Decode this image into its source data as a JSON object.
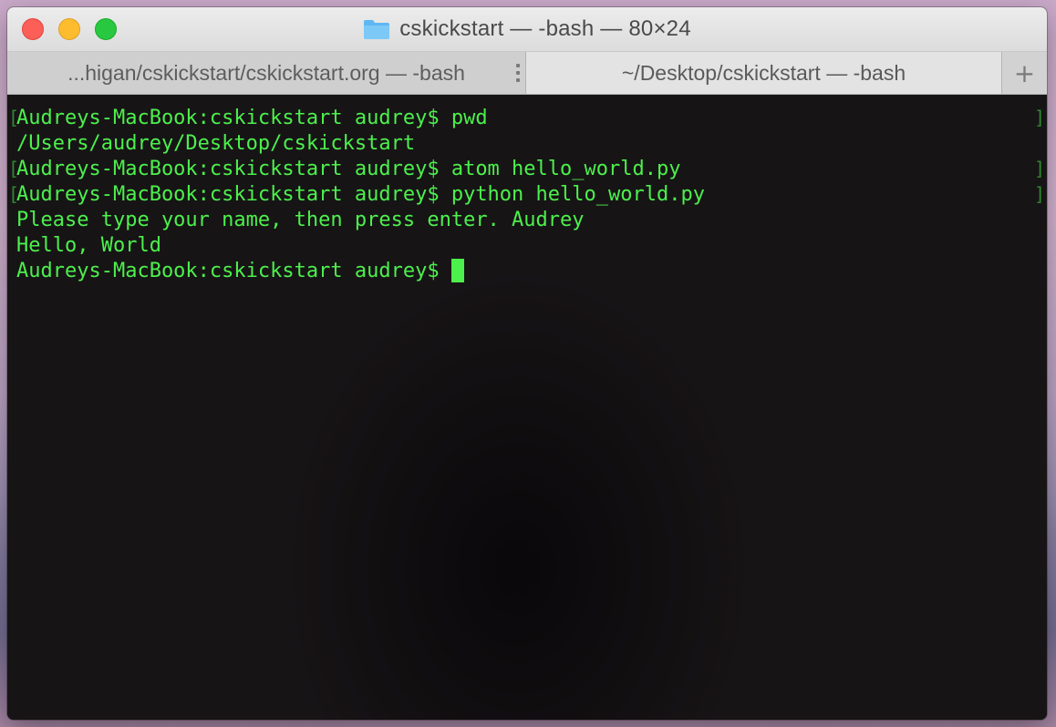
{
  "window": {
    "title": "cskickstart — -bash — 80×24",
    "folder_icon": "folder-icon"
  },
  "tabs": [
    {
      "label": "...higan/cskickstart/cskickstart.org — -bash",
      "active": false
    },
    {
      "label": "~/Desktop/cskickstart — -bash",
      "active": true
    }
  ],
  "new_tab_label": "+",
  "terminal": {
    "lines": [
      "Audreys-MacBook:cskickstart audrey$ pwd",
      "/Users/audrey/Desktop/cskickstart",
      "Audreys-MacBook:cskickstart audrey$ atom hello_world.py",
      "Audreys-MacBook:cskickstart audrey$ python hello_world.py",
      "Please type your name, then press enter. Audrey",
      "Hello, World",
      "Audreys-MacBook:cskickstart audrey$ "
    ],
    "bracket_open": "[",
    "bracket_close": "]",
    "text_color": "#4cf04c",
    "background_color": "#171416"
  }
}
